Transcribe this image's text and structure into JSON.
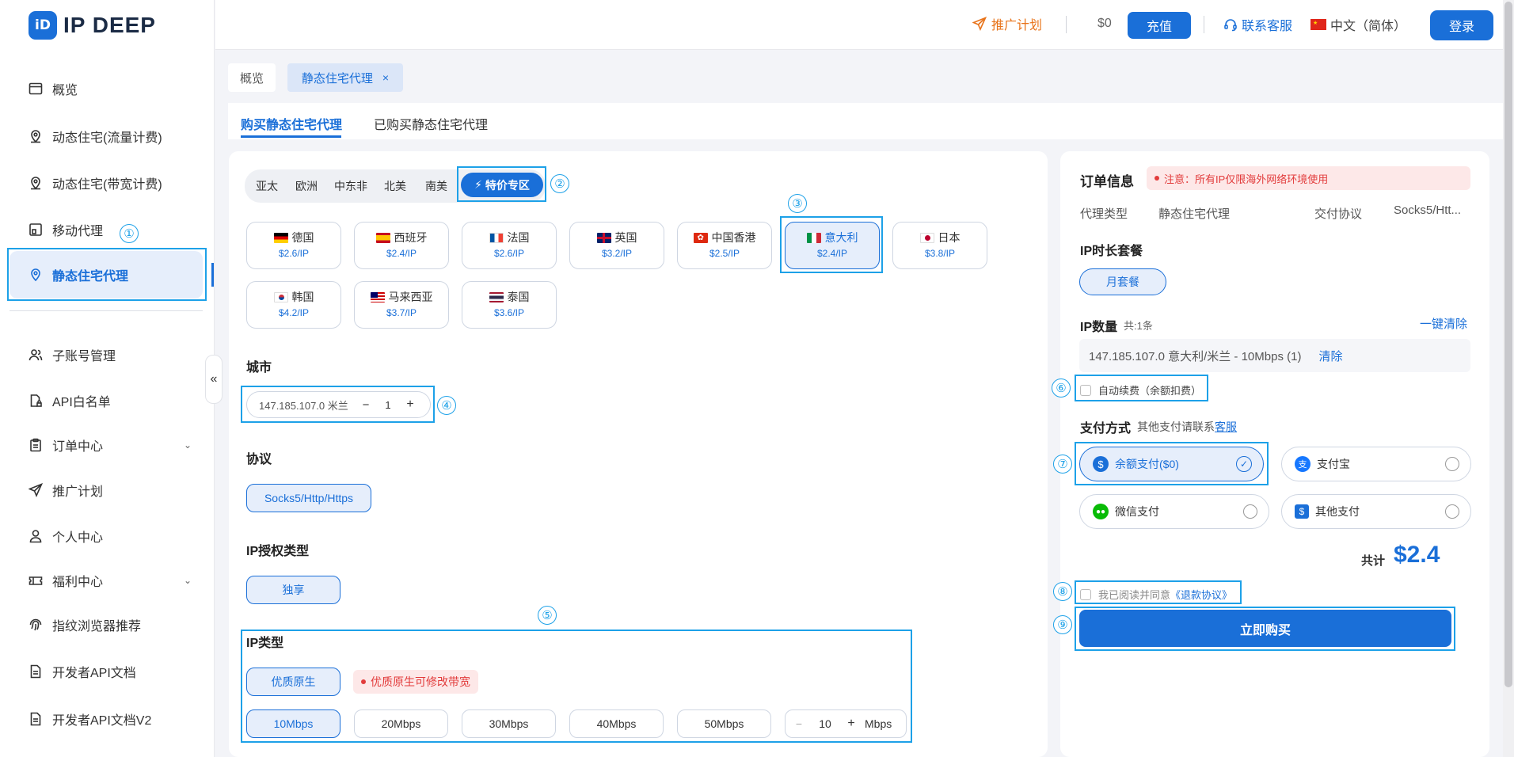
{
  "app": {
    "logo_mark": "iD",
    "name": "IP DEEP"
  },
  "sidebar": {
    "items": [
      {
        "label": "概览"
      },
      {
        "label": "动态住宅(流量计费)"
      },
      {
        "label": "动态住宅(带宽计费)"
      },
      {
        "label": "移动代理"
      },
      {
        "label": "静态住宅代理"
      },
      {
        "label": "子账号管理"
      },
      {
        "label": "API白名单"
      },
      {
        "label": "订单中心"
      },
      {
        "label": "推广计划"
      },
      {
        "label": "个人中心"
      },
      {
        "label": "福利中心"
      },
      {
        "label": "指纹浏览器推荐"
      },
      {
        "label": "开发者API文档"
      },
      {
        "label": "开发者API文档V2"
      }
    ],
    "collapse_glyph": "«"
  },
  "header": {
    "promo": "推广计划",
    "balance": "$0",
    "recharge": "充值",
    "support": "联系客服",
    "language": "中文（简体）",
    "login": "登录"
  },
  "page_tabs": {
    "overview": "概览",
    "current": "静态住宅代理",
    "close": "×"
  },
  "sub_tabs": {
    "buy": "购买静态住宅代理",
    "bought": "已购买静态住宅代理"
  },
  "regions": [
    "亚太",
    "欧洲",
    "中东非",
    "北美",
    "南美"
  ],
  "special_region": "特价专区",
  "countries": [
    {
      "name": "德国",
      "price": "$2.6/IP"
    },
    {
      "name": "西班牙",
      "price": "$2.4/IP"
    },
    {
      "name": "法国",
      "price": "$2.6/IP"
    },
    {
      "name": "英国",
      "price": "$3.2/IP"
    },
    {
      "name": "中国香港",
      "price": "$2.5/IP"
    },
    {
      "name": "意大利",
      "price": "$2.4/IP"
    },
    {
      "name": "日本",
      "price": "$3.8/IP"
    },
    {
      "name": "韩国",
      "price": "$4.2/IP"
    },
    {
      "name": "马来西亚",
      "price": "$3.7/IP"
    },
    {
      "name": "泰国",
      "price": "$3.6/IP"
    }
  ],
  "city": {
    "title": "城市",
    "ip": "147.185.107.0 米兰",
    "qty": "1",
    "minus": "−",
    "plus": "+"
  },
  "protocol": {
    "title": "协议",
    "value": "Socks5/Http/Https"
  },
  "auth": {
    "title": "IP授权类型",
    "value": "独享"
  },
  "ip_type": {
    "title": "IP类型",
    "value": "优质原生",
    "note": "优质原生可修改带宽",
    "bandwidths": [
      "10Mbps",
      "20Mbps",
      "30Mbps",
      "40Mbps",
      "50Mbps"
    ],
    "custom_value": "10",
    "unit": "Mbps"
  },
  "order": {
    "title": "订单信息",
    "notice": "注意：所有IP仅限海外网络环境使用",
    "proxy_type_label": "代理类型",
    "proxy_type_value": "静态住宅代理",
    "protocol_label": "交付协议",
    "protocol_value": "Socks5/Htt...",
    "duration_title": "IP时长套餐",
    "duration_value": "月套餐",
    "qty_title": "IP数量",
    "qty_count": "共:1条",
    "clear_all": "一键清除",
    "line_item": "147.185.107.0 意大利/米兰 - 10Mbps (1)",
    "clear": "清除",
    "auto_renew": "自动续费（余额扣费）",
    "pay_title": "支付方式",
    "pay_hint": "其他支付请联系",
    "pay_hint_link": "客服",
    "methods": [
      {
        "label": "余额支付($0)"
      },
      {
        "label": "支付宝"
      },
      {
        "label": "微信支付"
      },
      {
        "label": "其他支付"
      }
    ],
    "total_label": "共计",
    "total_value": "$2.4",
    "agree": "我已阅读并同意",
    "agree_link": "《退款协议》",
    "buy": "立即购买"
  },
  "markers": [
    "①",
    "②",
    "③",
    "④",
    "⑤",
    "⑥",
    "⑦",
    "⑧",
    "⑨"
  ],
  "colors": {
    "accent": "#1a6fd8",
    "highlight": "#1da1e8",
    "promo": "#e8731a",
    "notice_red": "#e23b3b"
  }
}
